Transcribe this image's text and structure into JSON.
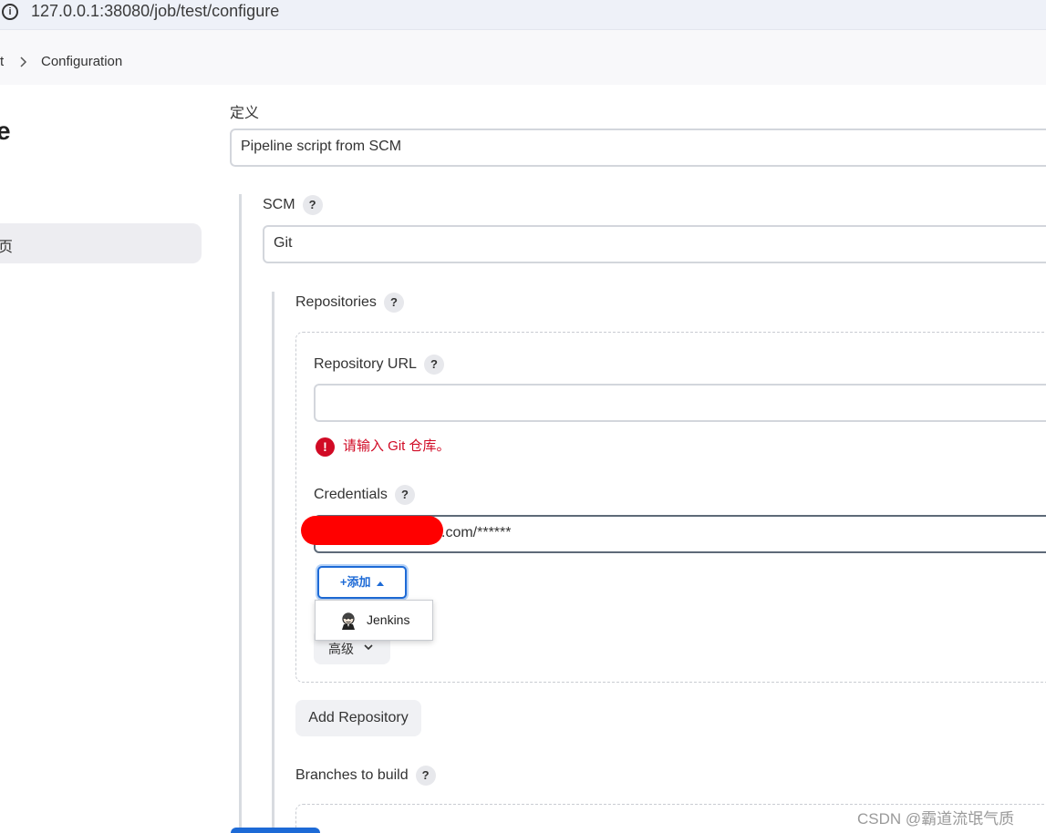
{
  "browser": {
    "url": "127.0.0.1:38080/job/test/configure"
  },
  "breadcrumb": {
    "prev": "t",
    "current": "Configuration"
  },
  "sidebar": {
    "title_fragment": "e",
    "item_fragment": "页"
  },
  "definition": {
    "label": "定义",
    "value": "Pipeline script from SCM"
  },
  "scm": {
    "label": "SCM",
    "value": "Git"
  },
  "repositories": {
    "label": "Repositories",
    "repo_url": {
      "label": "Repository URL",
      "value": "",
      "error": "请输入 Git 仓库。"
    },
    "credentials": {
      "label": "Credentials",
      "value": ".com/******"
    },
    "add_button": "+添加",
    "add_menu": {
      "items": [
        "Jenkins"
      ]
    },
    "advanced_button": "高级",
    "add_repository_button": "Add Repository"
  },
  "branches": {
    "label": "Branches to build"
  },
  "help_glyph": "?",
  "error_glyph": "!",
  "watermark": "CSDN @霸道流氓气质"
}
